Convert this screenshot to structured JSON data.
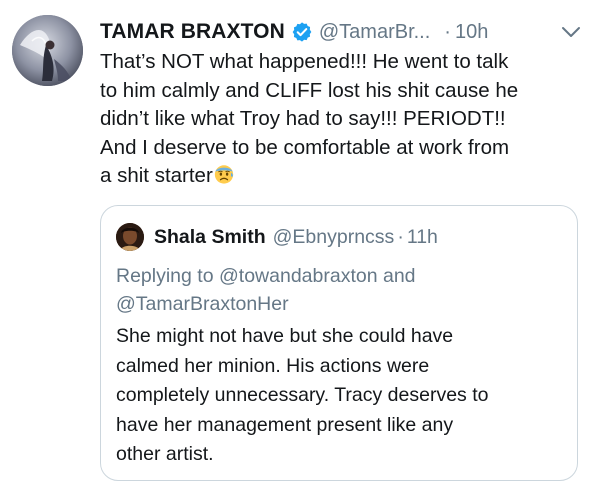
{
  "tweet": {
    "author_name": "TAMAR BRAXTON",
    "author_handle": "@TamarBr...",
    "separator": "·",
    "time": "10h",
    "text_lines": [
      "That’s NOT what happened!!! He went to talk",
      "to him calmly and CLIFF lost his shit cause he",
      "didn’t like what Troy had to say!!! PERIODT!!",
      "And I deserve to be comfortable at work from",
      "a shit starter"
    ],
    "emoji": "anxious-face-with-sweat",
    "verified_color": "#1da1f2"
  },
  "quoted_tweet": {
    "author_name": "Shala Smith",
    "author_handle": "@Ebnyprncss",
    "separator": "·",
    "time": "11h",
    "replying_prefix": "Replying to",
    "replying_mention_1": "@towandabraxton",
    "replying_and": "and",
    "replying_mention_2": "@TamarBraxtonHer",
    "text_lines": [
      "She might not have but she could have",
      "calmed her minion. His actions were",
      "completely unnecessary. Tracy deserves to",
      "have her management present like any",
      "other artist."
    ]
  },
  "icons": {
    "verified": "verified-badge-icon",
    "caret": "chevron-down-icon"
  },
  "colors": {
    "text": "#14171a",
    "muted": "#657786",
    "border": "#ccd6dd",
    "accent": "#1da1f2"
  }
}
